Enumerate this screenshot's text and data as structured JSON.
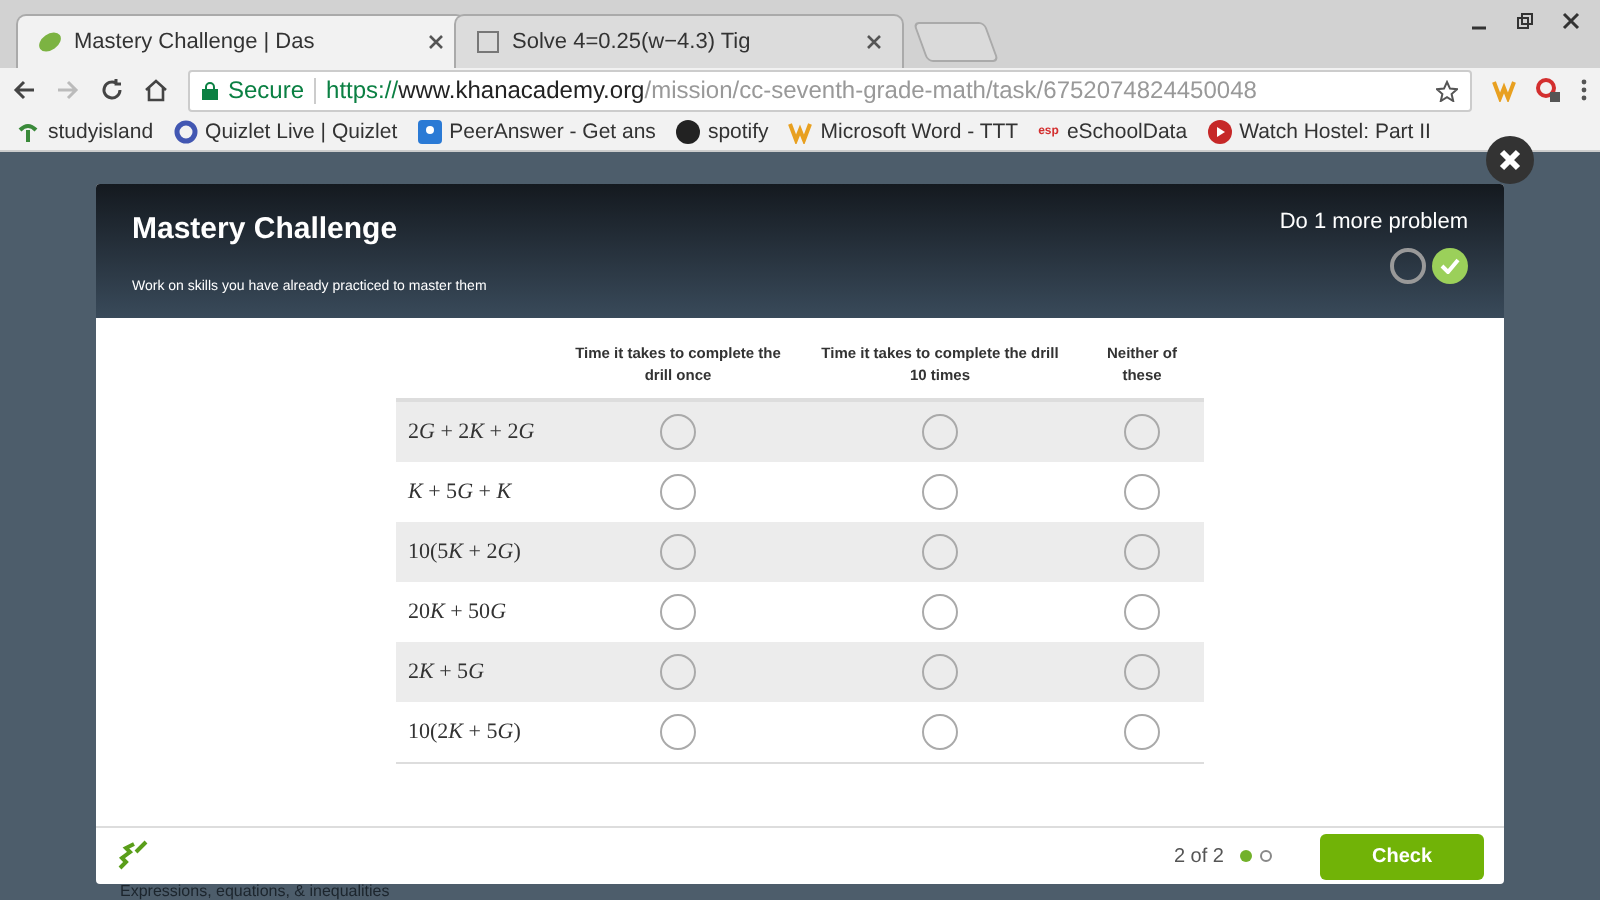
{
  "browser": {
    "tabs": [
      {
        "title": "Mastery Challenge | Das",
        "selected": true
      },
      {
        "title": "Solve 4=0.25(w−4.3) Tig",
        "selected": false
      }
    ],
    "address": {
      "secure_label": "Secure",
      "scheme": "https://",
      "host": "www.khanacademy.org",
      "path": "/mission/cc-seventh-grade-math/task/6752074824450048"
    },
    "bookmarks": [
      {
        "label": "studyisland",
        "kind": "palm"
      },
      {
        "label": "Quizlet Live | Quizlet",
        "kind": "quizlet"
      },
      {
        "label": "PeerAnswer - Get ans",
        "kind": "peer"
      },
      {
        "label": "spotify",
        "kind": "spotify"
      },
      {
        "label": "Microsoft Word - TTT",
        "kind": "word"
      },
      {
        "label": "eSchoolData",
        "kind": "esp",
        "badge": "esp"
      },
      {
        "label": "Watch Hostel: Part II",
        "kind": "play"
      }
    ]
  },
  "background_text": "Expressions, equations, & inequalities",
  "modal": {
    "title": "Mastery Challenge",
    "subtitle": "Work on skills you have already practiced to master them",
    "progress_label": "Do 1 more problem",
    "progress": [
      {
        "done": false
      },
      {
        "done": true
      }
    ],
    "table": {
      "columns": [
        "Time it takes to complete the drill once",
        "Time it takes to complete the drill **10** times",
        "Neither of these"
      ],
      "rows": [
        {
          "expression": "2G + 2K + 2G",
          "choices": [
            {
              "selected": false
            },
            {
              "selected": false
            },
            {
              "selected": false
            }
          ]
        },
        {
          "expression": "K + 5G + K",
          "choices": [
            {
              "selected": false
            },
            {
              "selected": false
            },
            {
              "selected": false
            }
          ]
        },
        {
          "expression": "10(5K + 2G)",
          "choices": [
            {
              "selected": false
            },
            {
              "selected": false
            },
            {
              "selected": false
            }
          ]
        },
        {
          "expression": "20K + 50G",
          "choices": [
            {
              "selected": false
            },
            {
              "selected": false
            },
            {
              "selected": false
            }
          ]
        },
        {
          "expression": "2K + 5G",
          "choices": [
            {
              "selected": false
            },
            {
              "selected": false
            },
            {
              "selected": false
            }
          ]
        },
        {
          "expression": "10(2K + 5G)",
          "choices": [
            {
              "selected": false
            },
            {
              "selected": false
            },
            {
              "selected": false
            }
          ]
        }
      ]
    },
    "footer": {
      "count": "2 of 2",
      "dots": [
        {
          "selected": true
        },
        {
          "selected": false
        }
      ],
      "button": "Check"
    }
  }
}
